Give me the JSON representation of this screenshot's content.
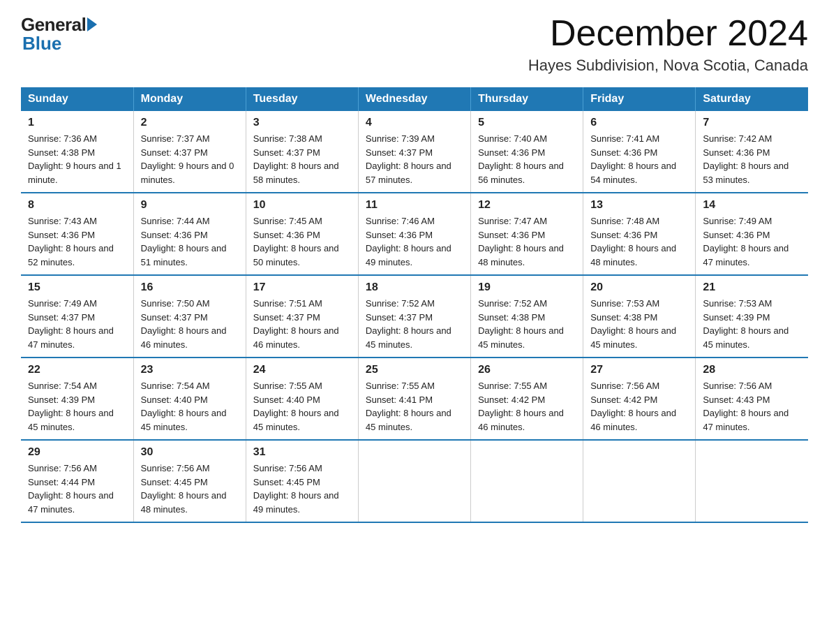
{
  "header": {
    "logo_general": "General",
    "logo_blue": "Blue",
    "month_title": "December 2024",
    "location": "Hayes Subdivision, Nova Scotia, Canada"
  },
  "days_of_week": [
    "Sunday",
    "Monday",
    "Tuesday",
    "Wednesday",
    "Thursday",
    "Friday",
    "Saturday"
  ],
  "weeks": [
    [
      {
        "num": "1",
        "sunrise": "7:36 AM",
        "sunset": "4:38 PM",
        "daylight": "9 hours and 1 minute."
      },
      {
        "num": "2",
        "sunrise": "7:37 AM",
        "sunset": "4:37 PM",
        "daylight": "9 hours and 0 minutes."
      },
      {
        "num": "3",
        "sunrise": "7:38 AM",
        "sunset": "4:37 PM",
        "daylight": "8 hours and 58 minutes."
      },
      {
        "num": "4",
        "sunrise": "7:39 AM",
        "sunset": "4:37 PM",
        "daylight": "8 hours and 57 minutes."
      },
      {
        "num": "5",
        "sunrise": "7:40 AM",
        "sunset": "4:36 PM",
        "daylight": "8 hours and 56 minutes."
      },
      {
        "num": "6",
        "sunrise": "7:41 AM",
        "sunset": "4:36 PM",
        "daylight": "8 hours and 54 minutes."
      },
      {
        "num": "7",
        "sunrise": "7:42 AM",
        "sunset": "4:36 PM",
        "daylight": "8 hours and 53 minutes."
      }
    ],
    [
      {
        "num": "8",
        "sunrise": "7:43 AM",
        "sunset": "4:36 PM",
        "daylight": "8 hours and 52 minutes."
      },
      {
        "num": "9",
        "sunrise": "7:44 AM",
        "sunset": "4:36 PM",
        "daylight": "8 hours and 51 minutes."
      },
      {
        "num": "10",
        "sunrise": "7:45 AM",
        "sunset": "4:36 PM",
        "daylight": "8 hours and 50 minutes."
      },
      {
        "num": "11",
        "sunrise": "7:46 AM",
        "sunset": "4:36 PM",
        "daylight": "8 hours and 49 minutes."
      },
      {
        "num": "12",
        "sunrise": "7:47 AM",
        "sunset": "4:36 PM",
        "daylight": "8 hours and 48 minutes."
      },
      {
        "num": "13",
        "sunrise": "7:48 AM",
        "sunset": "4:36 PM",
        "daylight": "8 hours and 48 minutes."
      },
      {
        "num": "14",
        "sunrise": "7:49 AM",
        "sunset": "4:36 PM",
        "daylight": "8 hours and 47 minutes."
      }
    ],
    [
      {
        "num": "15",
        "sunrise": "7:49 AM",
        "sunset": "4:37 PM",
        "daylight": "8 hours and 47 minutes."
      },
      {
        "num": "16",
        "sunrise": "7:50 AM",
        "sunset": "4:37 PM",
        "daylight": "8 hours and 46 minutes."
      },
      {
        "num": "17",
        "sunrise": "7:51 AM",
        "sunset": "4:37 PM",
        "daylight": "8 hours and 46 minutes."
      },
      {
        "num": "18",
        "sunrise": "7:52 AM",
        "sunset": "4:37 PM",
        "daylight": "8 hours and 45 minutes."
      },
      {
        "num": "19",
        "sunrise": "7:52 AM",
        "sunset": "4:38 PM",
        "daylight": "8 hours and 45 minutes."
      },
      {
        "num": "20",
        "sunrise": "7:53 AM",
        "sunset": "4:38 PM",
        "daylight": "8 hours and 45 minutes."
      },
      {
        "num": "21",
        "sunrise": "7:53 AM",
        "sunset": "4:39 PM",
        "daylight": "8 hours and 45 minutes."
      }
    ],
    [
      {
        "num": "22",
        "sunrise": "7:54 AM",
        "sunset": "4:39 PM",
        "daylight": "8 hours and 45 minutes."
      },
      {
        "num": "23",
        "sunrise": "7:54 AM",
        "sunset": "4:40 PM",
        "daylight": "8 hours and 45 minutes."
      },
      {
        "num": "24",
        "sunrise": "7:55 AM",
        "sunset": "4:40 PM",
        "daylight": "8 hours and 45 minutes."
      },
      {
        "num": "25",
        "sunrise": "7:55 AM",
        "sunset": "4:41 PM",
        "daylight": "8 hours and 45 minutes."
      },
      {
        "num": "26",
        "sunrise": "7:55 AM",
        "sunset": "4:42 PM",
        "daylight": "8 hours and 46 minutes."
      },
      {
        "num": "27",
        "sunrise": "7:56 AM",
        "sunset": "4:42 PM",
        "daylight": "8 hours and 46 minutes."
      },
      {
        "num": "28",
        "sunrise": "7:56 AM",
        "sunset": "4:43 PM",
        "daylight": "8 hours and 47 minutes."
      }
    ],
    [
      {
        "num": "29",
        "sunrise": "7:56 AM",
        "sunset": "4:44 PM",
        "daylight": "8 hours and 47 minutes."
      },
      {
        "num": "30",
        "sunrise": "7:56 AM",
        "sunset": "4:45 PM",
        "daylight": "8 hours and 48 minutes."
      },
      {
        "num": "31",
        "sunrise": "7:56 AM",
        "sunset": "4:45 PM",
        "daylight": "8 hours and 49 minutes."
      },
      null,
      null,
      null,
      null
    ]
  ]
}
